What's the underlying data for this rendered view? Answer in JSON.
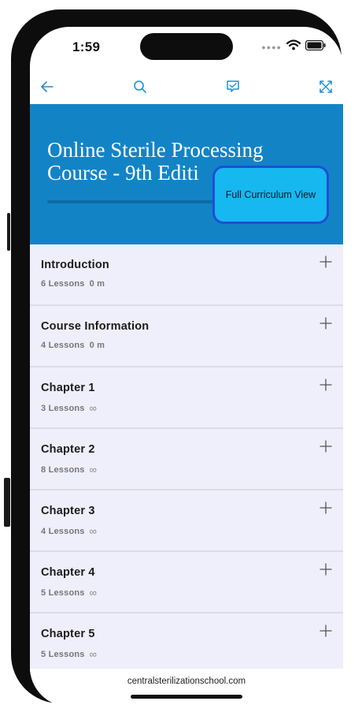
{
  "status_bar": {
    "time": "1:59"
  },
  "toolbar": {
    "back_icon": "arrow-left-icon",
    "search_icon": "search-icon",
    "chat_icon": "chat-bubble-icon",
    "expand_icon": "expand-icon",
    "accent_color": "#1f8fd6"
  },
  "hero": {
    "title": "Online Sterile Processing\nCourse - 9th Editi",
    "background_color": "#1284c6"
  },
  "curriculum_button": {
    "label": "Full Curriculum View"
  },
  "sections": [
    {
      "title": "Introduction",
      "lessons": "6 Lessons",
      "duration": "0 m"
    },
    {
      "title": "Course Information",
      "lessons": "4 Lessons",
      "duration": "0 m"
    },
    {
      "title": "Chapter 1",
      "lessons": "3 Lessons",
      "duration": "∞"
    },
    {
      "title": "Chapter 2",
      "lessons": "8 Lessons",
      "duration": "∞"
    },
    {
      "title": "Chapter 3",
      "lessons": "4 Lessons",
      "duration": "∞"
    },
    {
      "title": "Chapter 4",
      "lessons": "5 Lessons",
      "duration": "∞"
    },
    {
      "title": "Chapter 5",
      "lessons": "5 Lessons",
      "duration": "∞"
    }
  ],
  "browser": {
    "url": "centralsterilizationschool.com"
  }
}
